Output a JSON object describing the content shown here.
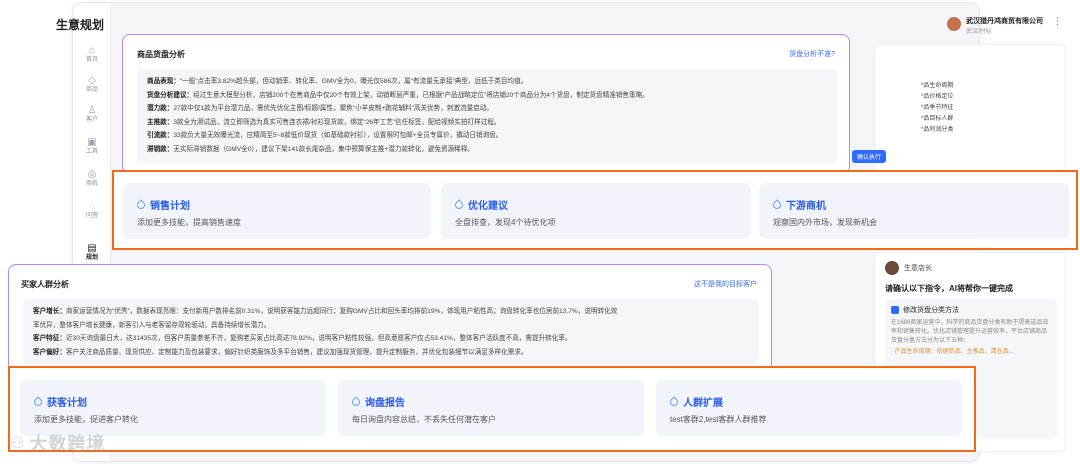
{
  "app": {
    "title": "生意规划",
    "company_name": "武汉猎丹鸿商贸有限公司",
    "company_sub": "武汉/时标",
    "more_icon": "more-icon"
  },
  "sidebar": {
    "items": [
      {
        "label": "首页",
        "icon": "⌂",
        "icon_name": "home-icon"
      },
      {
        "label": "商品",
        "icon": "◇",
        "icon_name": "tag-icon"
      },
      {
        "label": "客户",
        "icon": "♙",
        "icon_name": "user-icon"
      },
      {
        "label": "工具",
        "icon": "▣",
        "icon_name": "toolbox-icon"
      },
      {
        "label": "商机",
        "icon": "◎",
        "icon_name": "coin-icon"
      },
      {
        "label": "问答",
        "icon": "◌",
        "icon_name": "chat-icon"
      },
      {
        "label": "规划",
        "icon": "▤",
        "icon_name": "chart-icon"
      }
    ]
  },
  "goods_analysis": {
    "title": "商品货盘分析",
    "link": "货盘分析不准?",
    "lines": [
      {
        "k": "商品表现：",
        "v": "“一般”点击率3.82%超头部，但动销率、转化率、GMV全为0，曝光仅586次，属“有流量无承接”典型，远低于类目均值。"
      },
      {
        "k": "货盘分析建议：",
        "v": "经过生意大模型分析，店铺200个在售商品中仅20个有效上架，动销断层严重，已根据“产品战略定位”将店铺20个商品分为4个货盘，制定货盘精准销售策略。"
      },
      {
        "k": "潜力款：",
        "v": "27款中仅1款为平台潜力品，需优先优化主图/标题/属性，聚焦“小羊皮制+跑花辅料”高关优势，刺激流量启动。"
      },
      {
        "k": "主推款：",
        "v": "3款全为测试品，流立即筛选为真实可售连衣裙/衬衫现货款，绑定“26年工艺”信任标签，配给视频实拍打样过程。"
      },
      {
        "k": "引流款：",
        "v": "33款负大量无效曝光流，应精简至5~8款低价现货（如基础款衬衫），设置限时包邮+全员专属价，撬动日销询盘。"
      },
      {
        "k": "滞销款：",
        "v": "无实际滞销数据（GMV全0），建议下架141款长尾杂品，集中预算保主推+潜力款转化，避免资源稀释。"
      }
    ]
  },
  "right_panel": {
    "items": [
      "*品生命周期",
      "*品价格定位",
      "*品季节特征",
      "*品目标人群",
      "*品利润分类"
    ],
    "button": "确认执行"
  },
  "actions_top": [
    {
      "title": "销售计划",
      "desc": "添加更多技能，提高销售速度"
    },
    {
      "title": "优化建议",
      "desc": "全盘排查，发现4个待优化项"
    },
    {
      "title": "下游商机",
      "desc": "观察国内外市场，发现新机会"
    }
  ],
  "ai_panel": {
    "agent_name": "生意店长",
    "prompt": "请确认以下指令，AI将帮你一键完成",
    "task_title": "修改货盘分类方法",
    "task_body": "在1688商家运营中，科学的商品货盘分类有助于提高选品效率和销售转化。优化店铺管理提升运营效率，平台店铺商品货盘分类方法分为以下五种：",
    "task_tip": "· 产品生命周期：依据新品、主推品、清仓品..."
  },
  "buyer_analysis": {
    "title": "买家人群分析",
    "link": "这不是我的目标客户",
    "lines": [
      {
        "k": "客户增长：",
        "v": "商家运营情况为“优秀”，数据表现亮眼：支付新用户数排名前0.31%，说明获客能力远超同行；复购GMV占比和回头率均排前19%，体现用户粘性高；询盘转化率也位居前13.7%，说明转化效"
      },
      {
        "k": "",
        "v": "率优异，整体客户增长健康，新客引入与老客留存双轮驱动，具备持续增长潜力。"
      },
      {
        "k": "客户特征：",
        "v": "近30天询盘最日大，达31435次，但客户质量参差不齐，复购老买家占比高达78.92%，说明客户粘性较强，但高意愿客户仅占53.41%，整体客户活跃度不高，需提升转化率。"
      },
      {
        "k": "客户偏好：",
        "v": "客户关注商品质量、现货供应、定制能力及包装要求，偏好针织类服饰及多平台销售，建议加强现货管理，提升定制服务，并优化包装细节以满足多样化需求。"
      }
    ]
  },
  "actions_bottom": [
    {
      "title": "获客计划",
      "desc": "添加更多技能，促进客户转化"
    },
    {
      "title": "询盘报告",
      "desc": "每日询盘内容总结，不丢失任何潜在客户"
    },
    {
      "title": "人群扩展",
      "desc": "test客群2,test客群人群推荐"
    }
  ],
  "watermark": "大数跨境",
  "colors": {
    "accent": "#2f6bff",
    "highlight_border": "#f06a1c",
    "card_border": "#b788e6"
  }
}
